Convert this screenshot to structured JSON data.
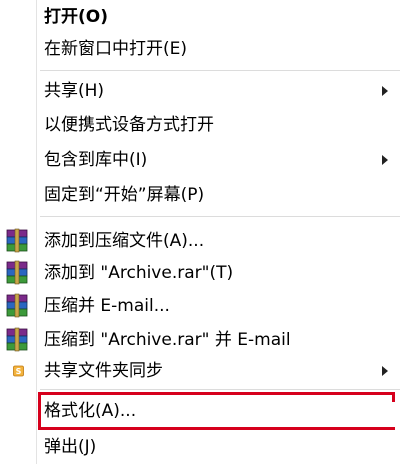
{
  "menu": {
    "items": [
      {
        "label": "打开(O)"
      },
      {
        "label": "在新窗口中打开(E)"
      },
      {
        "label": "共享(H)"
      },
      {
        "label": "以便携式设备方式打开"
      },
      {
        "label": "包含到库中(I)"
      },
      {
        "label": "固定到“开始”屏幕(P)"
      },
      {
        "label": "添加到压缩文件(A)...",
        "icon": "winrar-books-icon"
      },
      {
        "label": "添加到 \"Archive.rar\"(T)",
        "icon": "winrar-books-icon"
      },
      {
        "label": "压缩并 E-mail...",
        "icon": "winrar-books-icon"
      },
      {
        "label": "压缩到 \"Archive.rar\" 并 E-mail",
        "icon": "winrar-books-icon"
      },
      {
        "label": "共享文件夹同步",
        "icon": "sync-share-icon"
      },
      {
        "label": "格式化(A)..."
      },
      {
        "label": "弹出(J)"
      }
    ]
  },
  "colors": {
    "highlight_border": "#d6001c",
    "separator": "#dcdcdc"
  }
}
